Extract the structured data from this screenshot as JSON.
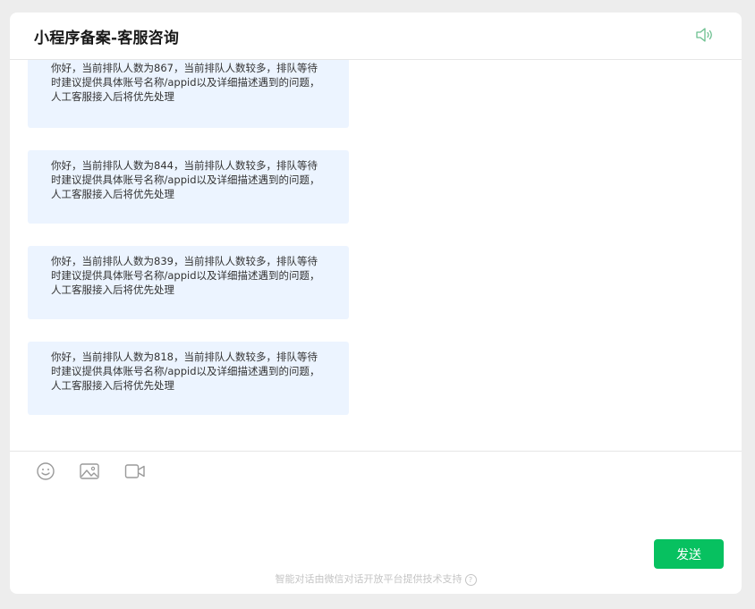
{
  "header": {
    "title": "小程序备案-客服咨询",
    "speaker_icon": "speaker-icon"
  },
  "messages": [
    {
      "text": "你好，当前排队人数为867，当前排队人数较多，排队等待时建议提供具体账号名称/appid以及详细描述遇到的问题，人工客服接入后将优先处理"
    },
    {
      "text": "你好，当前排队人数为844，当前排队人数较多，排队等待时建议提供具体账号名称/appid以及详细描述遇到的问题，人工客服接入后将优先处理"
    },
    {
      "text": "你好，当前排队人数为839，当前排队人数较多，排队等待时建议提供具体账号名称/appid以及详细描述遇到的问题，人工客服接入后将优先处理"
    },
    {
      "text": "你好，当前排队人数为818，当前排队人数较多，排队等待时建议提供具体账号名称/appid以及详细描述遇到的问题，人工客服接入后将优先处理"
    }
  ],
  "toolbar": {
    "icons": [
      "emoji-icon",
      "image-icon",
      "video-icon"
    ]
  },
  "input": {
    "send_label": "发送"
  },
  "footer": {
    "text": "智能对话由微信对话开放平台提供技术支持"
  },
  "colors": {
    "accent": "#07c160",
    "bubble": "#ecf4ff",
    "background": "#ededed"
  }
}
